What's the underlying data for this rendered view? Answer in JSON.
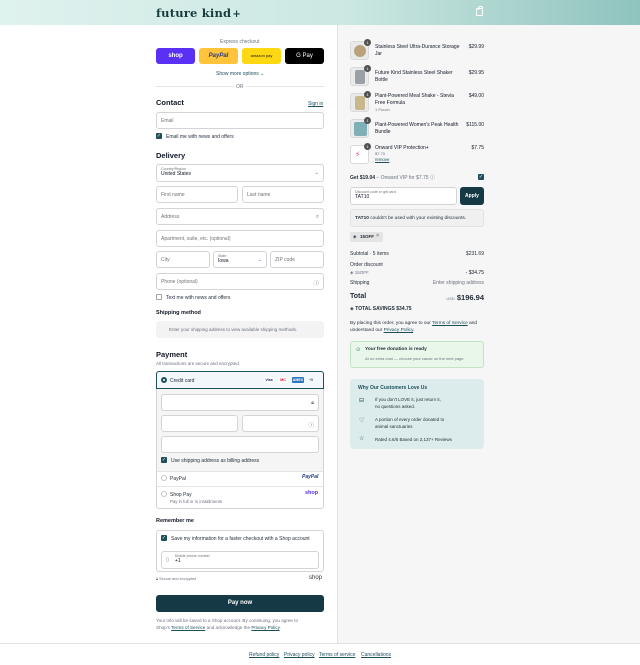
{
  "brand": {
    "logo": "future kind",
    "logo_mark": "+"
  },
  "express": {
    "title": "Express checkout",
    "buttons": [
      {
        "label": "shop",
        "color": "#5a31f4"
      },
      {
        "label": "PayPal",
        "color": "#ffc439"
      },
      {
        "label": "amazon pay",
        "color": "#ffd814"
      },
      {
        "label": "G Pay",
        "color": "#000000"
      }
    ],
    "show_more": "Show more options",
    "or": "OR"
  },
  "contact": {
    "title": "Contact",
    "sign_in": "Sign in",
    "email_placeholder": "Email",
    "email_news": "Email me with news and offers"
  },
  "delivery": {
    "title": "Delivery",
    "country_label": "Country/Region",
    "country_value": "United States",
    "first_name": "First name",
    "last_name": "Last name",
    "address": "Address",
    "apartment": "Apartment, suite, etc. (optional)",
    "city": "City",
    "state_label": "State",
    "state_value": "Iowa",
    "zip": "ZIP code",
    "phone": "Phone (optional)",
    "text_news": "Text me with news and offers"
  },
  "shipping": {
    "title": "Shipping method",
    "note": "Enter your shipping address to view available shipping methods."
  },
  "payment": {
    "title": "Payment",
    "subtitle": "All transactions are secure and encrypted.",
    "credit_card": "Credit card",
    "card_badges": [
      "Visa",
      "MC",
      "AMEX",
      "+5"
    ],
    "billing_same": "Use shipping address as billing address",
    "paypal": "PayPal",
    "paypal_logo": "PayPal",
    "shop_pay": "Shop Pay",
    "shop_pay_sub": "Pay in full or in installments",
    "shop_logo": "shop"
  },
  "remember": {
    "title": "Remember me",
    "save_info": "Save my information for a faster checkout with a Shop account",
    "mobile_label": "Mobile phone number",
    "mobile_value": "+1",
    "secure": "Secure and encrypted",
    "shop_logo": "shop"
  },
  "pay_button": "Pay now",
  "legal": {
    "line1": "Your info will be saved to a Shop account. By continuing, you agree to",
    "line2_pre": "Shop's ",
    "terms": "Terms of Service",
    "line2_mid": " and acknowledge the ",
    "privacy": "Privacy Policy",
    "end": "."
  },
  "cart": {
    "items": [
      {
        "name_1": "Stainless Steel Ultra-Durance Storage",
        "name_2": "Jar",
        "sub": "",
        "price": "$29.99",
        "qty": "1",
        "color": "#b9a27a"
      },
      {
        "name_1": "Future Kind Stainless Steel Shaker",
        "name_2": "Bottle",
        "sub": "",
        "price": "$29.95",
        "qty": "1",
        "color": "#9aa0a6"
      },
      {
        "name_1": "Plant-Powered Meal Shake - Stevia",
        "name_2": "Free Formula",
        "sub": "1 Pouch",
        "price": "$49.00",
        "qty": "1",
        "color": "#c9b88c"
      },
      {
        "name_1": "Plant-Powered Women's Peak Health",
        "name_2": "Bundle",
        "sub": "",
        "price": "$115.00",
        "qty": "1",
        "color": "#7fb0b8"
      },
      {
        "name_1": "Onward VIP Protection+",
        "name_2": "",
        "sub": "$7.75",
        "price": "$7.75",
        "qty": "1",
        "color": "#e0457b",
        "remove": "remove"
      }
    ]
  },
  "vip": {
    "get": "Get $19.04",
    "rest": " – Onward VIP for $7.75"
  },
  "discount": {
    "label": "Discount code or gift card",
    "value": "TAT10",
    "apply": "Apply",
    "error_code": "TAT10",
    "error_rest": " couldn't be used with your existing discounts.",
    "tag": "15OFF"
  },
  "summary": {
    "subtotal_label": "Subtotal · 5 items",
    "subtotal_value": "$231.69",
    "order_discount": "Order discount",
    "discount_code": "15OFF",
    "discount_value": "- $34.75",
    "shipping_label": "Shipping",
    "shipping_value": "Enter shipping address",
    "total_label": "Total",
    "currency": "USD",
    "total_value": "$196.94",
    "savings_label": "TOTAL SAVINGS",
    "savings_value": "$34.75"
  },
  "agree": {
    "pre": "By placing this order, you agree to our ",
    "terms": "Terms of Service",
    "mid": " and",
    "line2_pre": "understand our ",
    "privacy": "Privacy Policy",
    "end": "."
  },
  "donation": {
    "title": "Your free donation is ready",
    "sub": "At no extra cost — choose your cause on the next page."
  },
  "reviews": {
    "title": "Why Our Customers Love Us",
    "items": [
      {
        "l1": "If you don't LOVE it, just return it,",
        "l2": "no questions asked."
      },
      {
        "l1": "A portion of every order donated to",
        "l2": "animal sanctuaries"
      },
      {
        "l1": "Rated 4.6/5 Based on 2,137+ Reviews",
        "l2": ""
      }
    ]
  },
  "footer": {
    "links": [
      "Refund policy",
      "Privacy policy",
      "Terms of service",
      "Cancellations"
    ]
  }
}
